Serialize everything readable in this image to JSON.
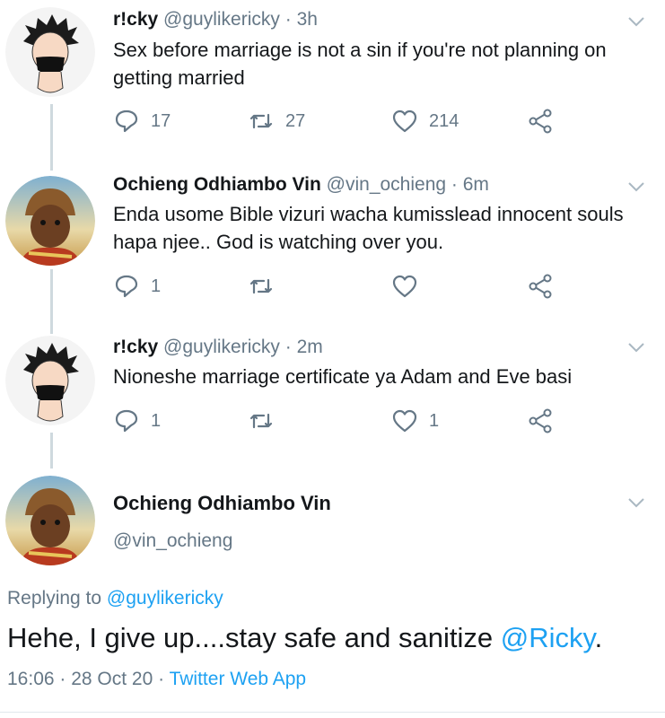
{
  "tweets": [
    {
      "name": "r!cky",
      "handle": "@guylikericky",
      "time": "3h",
      "text": "Sex before marriage is not a sin if you're not planning on getting married",
      "replies": "17",
      "retweets": "27",
      "likes": "214"
    },
    {
      "name": "Ochieng Odhiambo Vin",
      "handle": "@vin_ochieng",
      "time": "6m",
      "text": "Enda usome Bible vizuri wacha kumisslead innocent souls hapa njee.. God is watching over you.",
      "replies": "1",
      "retweets": "",
      "likes": ""
    },
    {
      "name": "r!cky",
      "handle": "@guylikericky",
      "time": "2m",
      "text": "Nioneshe marriage certificate ya Adam and Eve basi",
      "replies": "1",
      "retweets": "",
      "likes": "1"
    }
  ],
  "main_tweet": {
    "name": "Ochieng Odhiambo Vin",
    "handle": "@vin_ochieng",
    "replying_prefix": "Replying to",
    "replying_to": "@guylikericky",
    "text": "Hehe, I give up....stay safe and sanitize",
    "mention": "@Ricky",
    "text_end": ".",
    "time": "16:06",
    "date": "28 Oct 20",
    "source": "Twitter Web App"
  },
  "separator": " · ",
  "colors": {
    "text": "#14171a",
    "secondary": "#657786",
    "link": "#1da1f2",
    "thread_line": "#cfd9de"
  },
  "icons": [
    "reply-icon",
    "retweet-icon",
    "like-icon",
    "share-icon",
    "chevron-down-icon"
  ]
}
